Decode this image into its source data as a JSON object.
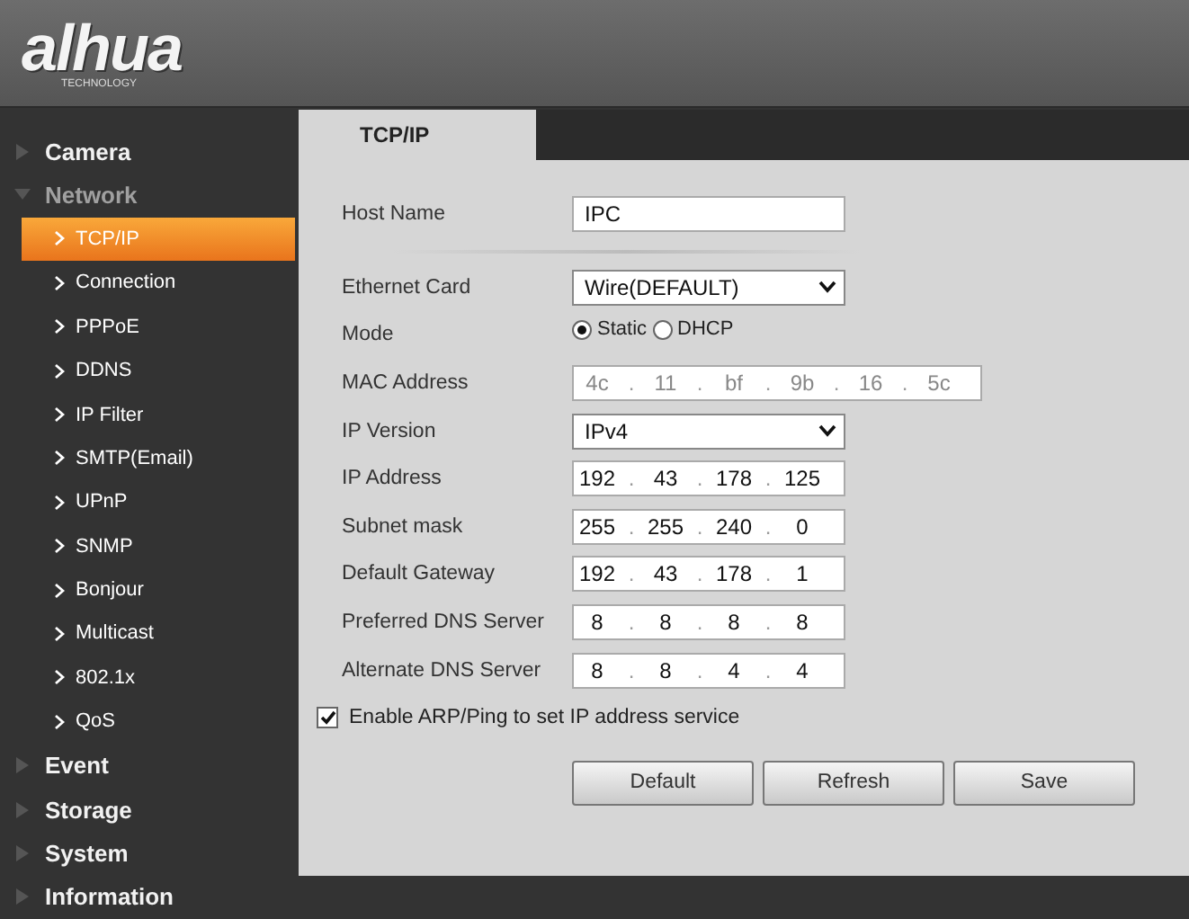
{
  "logo": {
    "text": "alhua",
    "tagline": "TECHNOLOGY"
  },
  "sidebar": {
    "items": [
      {
        "label": "Camera",
        "expanded": false
      },
      {
        "label": "Network",
        "expanded": true,
        "children": [
          {
            "label": "TCP/IP",
            "selected": true
          },
          {
            "label": "Connection",
            "selected": false
          },
          {
            "label": "PPPoE",
            "selected": false
          },
          {
            "label": "DDNS",
            "selected": false
          },
          {
            "label": "IP Filter",
            "selected": false
          },
          {
            "label": "SMTP(Email)",
            "selected": false
          },
          {
            "label": "UPnP",
            "selected": false
          },
          {
            "label": "SNMP",
            "selected": false
          },
          {
            "label": "Bonjour",
            "selected": false
          },
          {
            "label": "Multicast",
            "selected": false
          },
          {
            "label": "802.1x",
            "selected": false
          },
          {
            "label": "QoS",
            "selected": false
          }
        ]
      },
      {
        "label": "Event",
        "expanded": false
      },
      {
        "label": "Storage",
        "expanded": false
      },
      {
        "label": "System",
        "expanded": false
      },
      {
        "label": "Information",
        "expanded": false
      }
    ]
  },
  "tabs": [
    {
      "label": "TCP/IP",
      "selected": true
    }
  ],
  "form": {
    "rows": [
      {
        "kind": "text",
        "label": "Host Name",
        "value": "IPC",
        "separator_after": true
      },
      {
        "kind": "select",
        "label": "Ethernet Card",
        "value": "Wire(DEFAULT)"
      },
      {
        "kind": "radio",
        "label": "Mode",
        "options": [
          {
            "label": "Static",
            "selected": true
          },
          {
            "label": "DHCP",
            "selected": false
          }
        ]
      },
      {
        "kind": "segments",
        "label": "MAC Address",
        "disabled": true,
        "delimiter": ".",
        "segments": [
          "4c",
          "11",
          "bf",
          "9b",
          "16",
          "5c"
        ]
      },
      {
        "kind": "select",
        "label": "IP Version",
        "value": "IPv4"
      },
      {
        "kind": "segments",
        "label": "IP Address",
        "disabled": false,
        "delimiter": ".",
        "segments": [
          "192",
          "43",
          "178",
          "125"
        ]
      },
      {
        "kind": "segments",
        "label": "Subnet mask",
        "disabled": false,
        "delimiter": ".",
        "segments": [
          "255",
          "255",
          "240",
          "0"
        ]
      },
      {
        "kind": "segments",
        "label": "Default Gateway",
        "disabled": false,
        "delimiter": ".",
        "segments": [
          "192",
          "43",
          "178",
          "1"
        ]
      },
      {
        "kind": "segments",
        "label": "Preferred DNS Server",
        "disabled": false,
        "delimiter": ".",
        "segments": [
          "8",
          "8",
          "8",
          "8"
        ]
      },
      {
        "kind": "segments",
        "label": "Alternate DNS Server",
        "disabled": false,
        "delimiter": ".",
        "segments": [
          "8",
          "8",
          "4",
          "4"
        ]
      }
    ],
    "checkbox": {
      "label": "Enable ARP/Ping to set IP address service",
      "checked": true
    },
    "buttons": [
      "Default",
      "Refresh",
      "Save"
    ]
  }
}
